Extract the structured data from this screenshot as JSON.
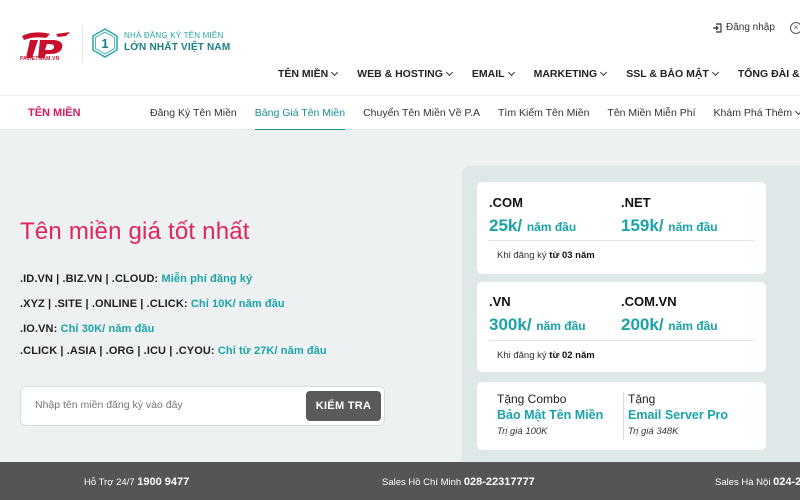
{
  "brand": {
    "logo_text": "PAVIETNAM.VN",
    "tagline_1": "NHÀ ĐĂNG KÝ TÊN MIỀN",
    "tagline_2": "LỚN NHẤT VIỆT NAM",
    "badge_number": "1",
    "colors": {
      "primary": "#c8102e",
      "teal": "#1aa3a8",
      "pink": "#e0245e"
    }
  },
  "top": {
    "login_label": "Đăng nhập"
  },
  "mainnav": [
    {
      "label": "TÊN MIỀN"
    },
    {
      "label": "WEB & HOSTING"
    },
    {
      "label": "EMAIL"
    },
    {
      "label": "MARKETING"
    },
    {
      "label": "SSL & BẢO MẬT"
    },
    {
      "label": "TỔNG ĐÀI & HÓA Đ"
    }
  ],
  "subnav": {
    "section": "TÊN MIỀN",
    "links": [
      {
        "label": "Đăng Ký Tên Miền"
      },
      {
        "label": "Bảng Giá Tên Miền",
        "active": true
      },
      {
        "label": "Chuyển Tên Miền Về P.A"
      },
      {
        "label": "Tìm Kiếm Tên Miền"
      },
      {
        "label": "Tên Miền Miễn Phí"
      },
      {
        "label": "Khám Phá Thêm"
      }
    ]
  },
  "hero": {
    "title": "Tên miền giá tốt nhất",
    "promos": [
      {
        "ext": ".ID.VN | .BIZ.VN | .CLOUD:",
        "offer": "Miễn phí đăng ký"
      },
      {
        "ext": ".XYZ | .SITE | .ONLINE | .CLICK:",
        "offer": "Chỉ 10K/ năm đầu"
      },
      {
        "ext": ".IO.VN:",
        "offer": "Chỉ 30K/ năm đầu"
      },
      {
        "ext": ".CLICK | .ASIA | .ORG | .ICU | .CYOU:",
        "offer": "Chỉ từ 27K/ năm đầu"
      }
    ],
    "search_placeholder": "Nhập tên miền đăng ký vào đây",
    "search_button": "KIỂM TRA"
  },
  "pricing": {
    "card1": {
      "a_ext": ".COM",
      "a_price": "25k/",
      "a_unit": "năm đầu",
      "b_ext": ".NET",
      "b_price": "159k/",
      "b_unit": "năm đầu",
      "note_prefix": "Khi đăng ký",
      "note_bold": "từ 03 năm"
    },
    "card2": {
      "a_ext": ".VN",
      "a_price": "300k/",
      "a_unit": "năm đầu",
      "b_ext": ".COM.VN",
      "b_price": "200k/",
      "b_unit": "năm đầu",
      "note_prefix": "Khi đăng ký",
      "note_bold": "từ 02 năm"
    },
    "combo": {
      "a_head": "Tặng Combo",
      "a_name": "Bảo Mật Tên Miền",
      "a_value": "Trị giá 100K",
      "b_head": "Tặng",
      "b_name": "Email Server Pro",
      "b_value": "Trị giá 348K"
    }
  },
  "footer": {
    "support_label": "Hỗ Trợ 24/7",
    "support_phone": "1900 9477",
    "hcm_label": "Sales Hồ Chí Minh",
    "hcm_phone": "028-22317777",
    "hn_label": "Sales Hà Nội",
    "hn_phone": "024-2"
  }
}
